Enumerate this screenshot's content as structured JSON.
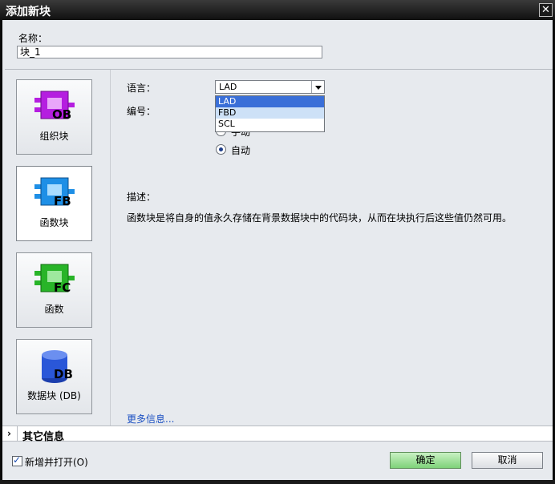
{
  "window": {
    "title": "添加新块",
    "close_symbol": "✕"
  },
  "name_field": {
    "label": "名称：",
    "value": "块_1"
  },
  "block_types": [
    {
      "label": "组织块",
      "badge": "OB",
      "color": "#b51ee0"
    },
    {
      "label": "函数块",
      "badge": "FB",
      "color": "#1e8fe6"
    },
    {
      "label": "函数",
      "badge": "FC",
      "color": "#28b428"
    },
    {
      "label": "数据块 (DB)",
      "badge": "DB",
      "color": "#2a57d8"
    }
  ],
  "language": {
    "label": "语言：",
    "value": "LAD",
    "options": [
      "LAD",
      "FBD",
      "SCL"
    ],
    "selected_option": "LAD",
    "hover_option": "FBD"
  },
  "number": {
    "label": "编号：",
    "manual_label": "手动",
    "auto_label": "自动"
  },
  "description": {
    "label": "描述：",
    "text": "函数块是将自身的值永久存储在背景数据块中的代码块，从而在块执行后这些值仍然可用。"
  },
  "more_info_link": "更多信息...",
  "other_info": {
    "label": "其它信息",
    "chevron": "›"
  },
  "footer": {
    "open_checkbox_label": "新增并打开(O)",
    "ok_label": "确定",
    "cancel_label": "取消"
  }
}
